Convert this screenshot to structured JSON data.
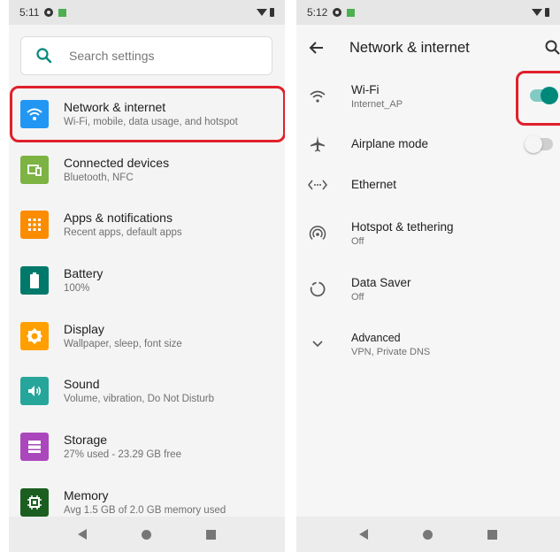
{
  "left": {
    "status": {
      "time": "5:11"
    },
    "search": {
      "placeholder": "Search settings"
    },
    "items": [
      {
        "title": "Network & internet",
        "sub": "Wi-Fi, mobile, data usage, and hotspot",
        "color": "#2196f3",
        "icon": "wifi-icon"
      },
      {
        "title": "Connected devices",
        "sub": "Bluetooth, NFC",
        "color": "#7cb342",
        "icon": "devices-icon"
      },
      {
        "title": "Apps & notifications",
        "sub": "Recent apps, default apps",
        "color": "#fb8c00",
        "icon": "apps-icon"
      },
      {
        "title": "Battery",
        "sub": "100%",
        "color": "#00796b",
        "icon": "battery-icon"
      },
      {
        "title": "Display",
        "sub": "Wallpaper, sleep, font size",
        "color": "#ffa000",
        "icon": "brightness-icon"
      },
      {
        "title": "Sound",
        "sub": "Volume, vibration, Do Not Disturb",
        "color": "#26a69a",
        "icon": "volume-icon"
      },
      {
        "title": "Storage",
        "sub": "27% used - 23.29 GB free",
        "color": "#ab47bc",
        "icon": "storage-icon"
      },
      {
        "title": "Memory",
        "sub": "Avg 1.5 GB of 2.0 GB memory used",
        "color": "#1b5e20",
        "icon": "memory-icon"
      }
    ]
  },
  "right": {
    "status": {
      "time": "5:12"
    },
    "title": "Network & internet",
    "items": [
      {
        "title": "Wi-Fi",
        "sub": "Internet_AP",
        "icon": "wifi-icon",
        "toggle": true
      },
      {
        "title": "Airplane mode",
        "sub": "",
        "icon": "airplane-icon",
        "toggle": false
      },
      {
        "title": "Ethernet",
        "sub": "",
        "icon": "ethernet-icon"
      },
      {
        "title": "Hotspot & tethering",
        "sub": "Off",
        "icon": "hotspot-icon"
      },
      {
        "title": "Data Saver",
        "sub": "Off",
        "icon": "data-saver-icon"
      },
      {
        "title": "Advanced",
        "sub": "VPN, Private DNS",
        "icon": "chevron-down-icon"
      }
    ]
  },
  "colors": {
    "accent": "#00897b",
    "highlight": "#e0202a"
  }
}
